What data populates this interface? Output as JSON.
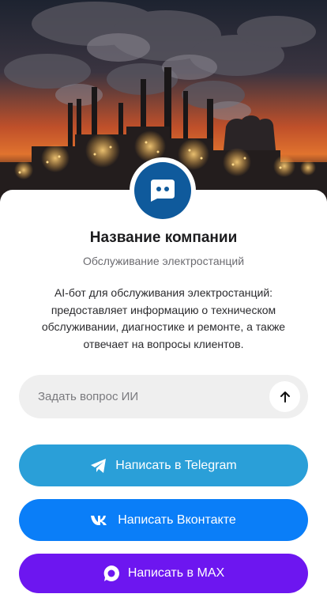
{
  "hero": {
    "image_name": "power-plant-sunset-image"
  },
  "company": {
    "name": "Название компании",
    "subtitle": "Обслуживание электростанций",
    "description": "AI-бот для обслуживания электростанций: предоставляет информацию о техническом обслуживании, диагностике и ремонте, а также отвечает на вопросы клиентов."
  },
  "ask": {
    "placeholder": "Задать вопрос ИИ",
    "send_icon": "arrow-up-icon"
  },
  "buttons": {
    "telegram": {
      "label": "Написать в Telegram",
      "icon": "telegram-icon",
      "color": "#2a9fd8"
    },
    "vk": {
      "label": "Написать Вконтакте",
      "icon": "vk-icon",
      "color": "#0a7ef8"
    },
    "max": {
      "label": "Написать в MAX",
      "icon": "max-icon",
      "color": "#6d16f0"
    }
  },
  "colors": {
    "avatar": "#0f5a9c",
    "input_bg": "#efefef"
  }
}
